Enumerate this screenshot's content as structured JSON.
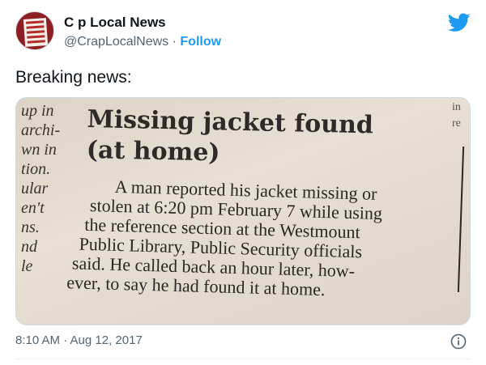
{
  "author": {
    "display_name": "C  p Local News",
    "handle": "@CrapLocalNews",
    "separator": " · ",
    "follow_label": "Follow"
  },
  "tweet_text": "Breaking news:",
  "photo": {
    "left_column": [
      "up in",
      "archi-",
      "wn in",
      "tion.",
      "ular",
      "en't",
      "ns.",
      "nd",
      "le"
    ],
    "right_column": [
      "in",
      "re"
    ],
    "headline_lines": [
      "Missing jacket found",
      "(at home)"
    ],
    "body_lines": [
      "A man reported his jacket missing or",
      "stolen at 6:20 pm February 7 while using",
      "the reference section at the Westmount",
      "Public Library, Public Security officials",
      "said. He called back an hour later, how-",
      "ever, to say he had found it at home."
    ]
  },
  "footer": {
    "timestamp": "8:10 AM · Aug 12, 2017"
  },
  "icons": {
    "brand": "twitter-bird-icon",
    "info": "info-icon"
  },
  "colors": {
    "accent": "#1d9bf0",
    "muted": "#536471"
  }
}
